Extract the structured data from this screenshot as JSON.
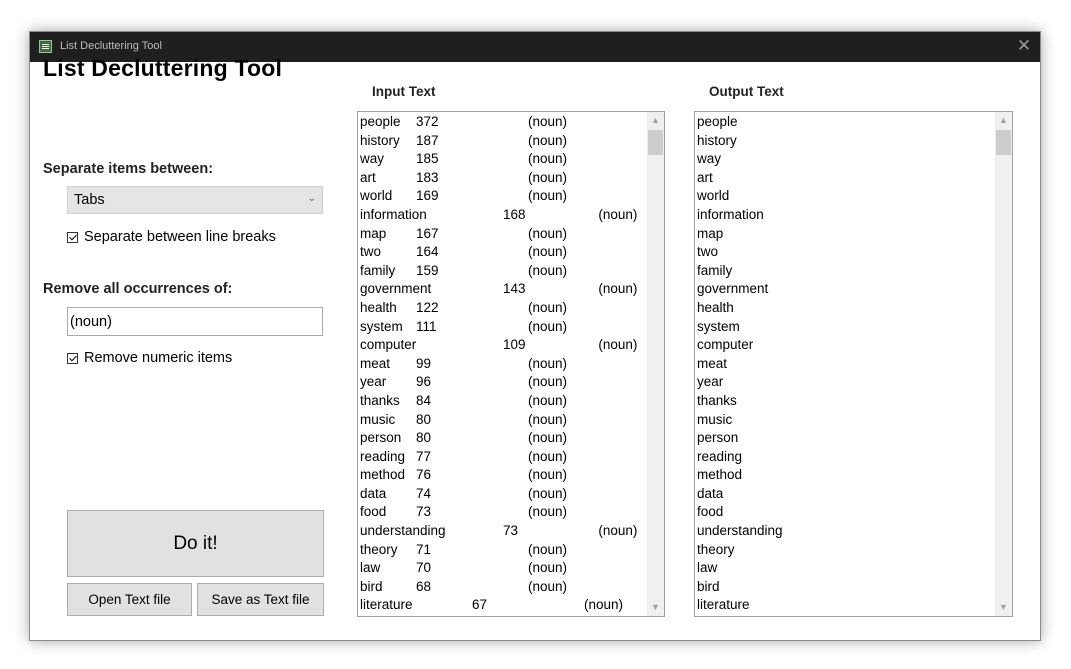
{
  "window": {
    "title": "List Decluttering Tool"
  },
  "app": {
    "heading": "List Decluttering Tool",
    "separate_label": "Separate items between:",
    "separator_value": "Tabs",
    "line_breaks_label": "Separate between line breaks",
    "line_breaks_checked": true,
    "remove_label": "Remove all occurrences of:",
    "remove_value": "(noun)",
    "numeric_label": "Remove numeric items",
    "numeric_checked": true,
    "do_it": "Do it!",
    "open_file": "Open Text file",
    "save_file": "Save as Text file"
  },
  "input_panel": {
    "header": "Input Text",
    "rows": [
      [
        "people",
        "372",
        "",
        "(noun)"
      ],
      [
        "history",
        "187",
        "",
        "(noun)"
      ],
      [
        "way",
        "185",
        "",
        "(noun)"
      ],
      [
        "art",
        "183",
        "",
        "(noun)"
      ],
      [
        "world",
        "169",
        "",
        "(noun)"
      ],
      [
        "information",
        "",
        "168",
        "",
        "(noun)"
      ],
      [
        "map",
        "167",
        "",
        "(noun)"
      ],
      [
        "two",
        "164",
        "",
        "(noun)"
      ],
      [
        "family",
        "159",
        "",
        "(noun)"
      ],
      [
        "government",
        "",
        "143",
        "",
        "(noun)"
      ],
      [
        "health",
        "122",
        "",
        "(noun)"
      ],
      [
        "system",
        "111",
        "",
        "(noun)"
      ],
      [
        "computer",
        "",
        "109",
        "",
        "(noun)"
      ],
      [
        "meat",
        "99",
        "",
        "(noun)"
      ],
      [
        "year",
        "96",
        "",
        "(noun)"
      ],
      [
        "thanks",
        "84",
        "",
        "(noun)"
      ],
      [
        "music",
        "80",
        "",
        "(noun)"
      ],
      [
        "person",
        "80",
        "",
        "(noun)"
      ],
      [
        "reading",
        "77",
        "",
        "(noun)"
      ],
      [
        "method",
        "76",
        "",
        "(noun)"
      ],
      [
        "data",
        "74",
        "",
        "(noun)"
      ],
      [
        "food",
        "73",
        "",
        "(noun)"
      ],
      [
        "understanding",
        "",
        "73",
        "",
        "(noun)"
      ],
      [
        "theory",
        "71",
        "",
        "(noun)"
      ],
      [
        "law",
        "70",
        "",
        "(noun)"
      ],
      [
        "bird",
        "68",
        "",
        "(noun)"
      ],
      [
        "literature",
        "67",
        "",
        "(noun)"
      ]
    ]
  },
  "output_panel": {
    "header": "Output Text",
    "lines": [
      "people",
      "history",
      "way",
      "art",
      "world",
      "information",
      "map",
      "two",
      "family",
      "government",
      "health",
      "system",
      "computer",
      "meat",
      "year",
      "thanks",
      "music",
      "person",
      "reading",
      "method",
      "data",
      "food",
      "understanding",
      "theory",
      "law",
      "bird",
      "literature"
    ]
  },
  "icons": {
    "app": "list-app-icon",
    "close": "close-icon",
    "dropdown": "chevron-down-icon",
    "scroll_up": "scroll-up-arrow-icon",
    "scroll_down": "scroll-down-arrow-icon"
  }
}
